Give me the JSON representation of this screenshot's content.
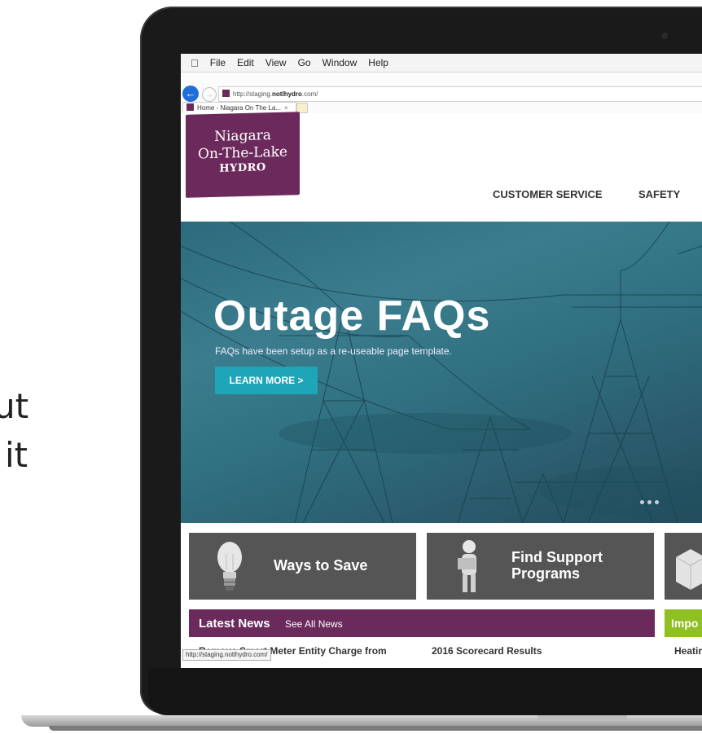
{
  "background_text": [
    "ut",
    "it"
  ],
  "menubar": {
    "apple": "",
    "items": [
      "File",
      "Edit",
      "View",
      "Go",
      "Window",
      "Help"
    ]
  },
  "browser": {
    "url_prefix": "http://staging.",
    "url_bold": "notlhydro",
    "url_suffix": ".com/",
    "tab_title": "Home - Niagara On The La...",
    "tab_close": "×",
    "status_url": "http://staging.notlhydro.com/"
  },
  "logo": {
    "line1": "Niagara",
    "line2": "On-The-Lake",
    "line3": "HYDRO",
    "color": "#6c2a5c"
  },
  "nav": {
    "items": [
      "CUSTOMER SERVICE",
      "SAFETY"
    ]
  },
  "hero": {
    "title": "Outage FAQs",
    "subtitle": "FAQs have been setup as a re-useable page template.",
    "button": "LEARN MORE >",
    "accent": "#1ea6b8"
  },
  "tiles": [
    {
      "label": "Ways to Save",
      "icon": "lightbulb-icon"
    },
    {
      "label_line1": "Find Support",
      "label_line2": "Programs",
      "icon": "person-puzzle-icon"
    },
    {
      "icon": "box-icon"
    }
  ],
  "news": {
    "heading": "Latest News",
    "see_all": "See All News",
    "items": [
      "Remove Smart Meter Entity Charge from",
      "2016 Scorecard Results"
    ],
    "color": "#6b2a5c"
  },
  "important": {
    "heading": "Impo",
    "item": "Heatir",
    "color": "#8fbf21"
  }
}
